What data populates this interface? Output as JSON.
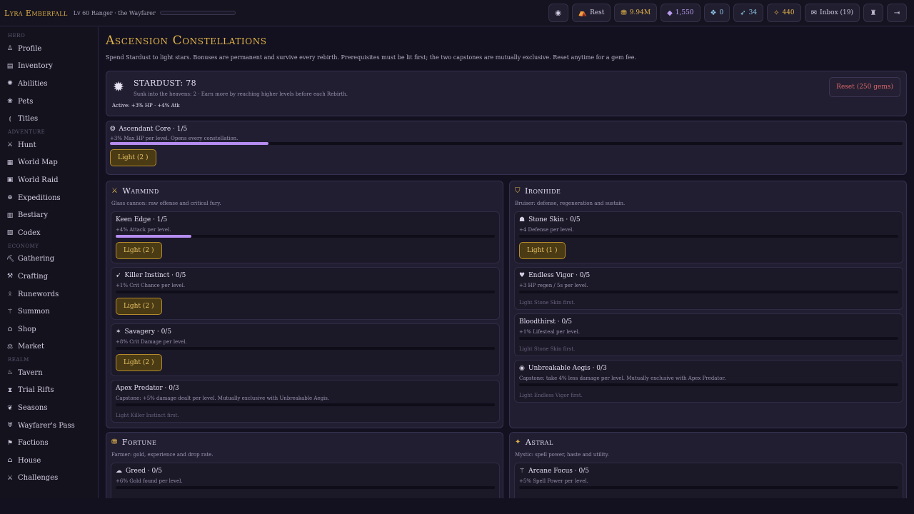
{
  "header": {
    "player_name": "Lyra Emberfall",
    "player_subtitle": "Lv 60 Ranger · the Wayfarer",
    "rest_label": "Rest",
    "gold": "9.94M",
    "gems": "1,550",
    "essence": "0",
    "feathers": "34",
    "stardust": "440",
    "inbox_label": "Inbox (19)"
  },
  "sidebar": {
    "sections": [
      {
        "label": "HERO",
        "items": [
          {
            "label": "Profile",
            "icon": "person-icon"
          },
          {
            "label": "Inventory",
            "icon": "backpack-icon"
          },
          {
            "label": "Abilities",
            "icon": "sparkle-icon"
          },
          {
            "label": "Pets",
            "icon": "paw-icon"
          },
          {
            "label": "Titles",
            "icon": "scroll-icon"
          }
        ]
      },
      {
        "label": "ADVENTURE",
        "items": [
          {
            "label": "Hunt",
            "icon": "swords-icon"
          },
          {
            "label": "World Map",
            "icon": "map-icon"
          },
          {
            "label": "World Raid",
            "icon": "raid-icon"
          },
          {
            "label": "Expeditions",
            "icon": "compass-icon"
          },
          {
            "label": "Bestiary",
            "icon": "book-icon"
          },
          {
            "label": "Codex",
            "icon": "codex-icon"
          }
        ]
      },
      {
        "label": "ECONOMY",
        "items": [
          {
            "label": "Gathering",
            "icon": "pickaxe-icon"
          },
          {
            "label": "Crafting",
            "icon": "anvil-icon"
          },
          {
            "label": "Runewords",
            "icon": "rune-icon"
          },
          {
            "label": "Summon",
            "icon": "wand-icon"
          },
          {
            "label": "Shop",
            "icon": "shop-icon"
          },
          {
            "label": "Market",
            "icon": "scale-icon"
          }
        ]
      },
      {
        "label": "REALM",
        "items": [
          {
            "label": "Tavern",
            "icon": "mug-icon"
          },
          {
            "label": "Trial Rifts",
            "icon": "rift-icon"
          },
          {
            "label": "Seasons",
            "icon": "leaf-icon"
          },
          {
            "label": "Wayfarer's Pass",
            "icon": "pass-icon"
          },
          {
            "label": "Factions",
            "icon": "flag-icon"
          },
          {
            "label": "House",
            "icon": "house-icon"
          },
          {
            "label": "Challenges",
            "icon": "challenge-icon"
          }
        ]
      }
    ]
  },
  "page": {
    "title": "Ascension Constellations",
    "description": "Spend Stardust to light stars. Bonuses are permanent and survive every rebirth. Prerequisites must be lit first; the two capstones are mutually exclusive. Reset anytime for a gem fee."
  },
  "stardust_card": {
    "title": "STARDUST: 78",
    "subtitle": "Sunk into the heavens: 2 · Earn more by reaching higher levels before each Rebirth.",
    "active": "Active: +3% HP · +4% Atk",
    "reset_label": "Reset (250 gems)"
  },
  "core": {
    "title": "Ascendant Core · 1/5",
    "desc": "+3% Max HP per level. Opens every constellation.",
    "progress": 0.2,
    "button": "Light (2 )"
  },
  "groups": {
    "warmind": {
      "name": "Warmind",
      "desc": "Glass cannon: raw offense and critical fury.",
      "nodes": [
        {
          "title": "Keen Edge · 1/5",
          "desc": "+4% Attack per level.",
          "progress": 0.2,
          "button": "Light (2 )"
        },
        {
          "title": "Killer Instinct · 0/5",
          "desc": "+1% Crit Chance per level.",
          "progress": 0,
          "button": "Light (2 )"
        },
        {
          "title": "Savagery · 0/5",
          "desc": "+8% Crit Damage per level.",
          "progress": 0,
          "button": "Light (2 )"
        },
        {
          "title": "Apex Predator · 0/3",
          "desc": "Capstone: +5% damage dealt per level. Mutually exclusive with Unbreakable Aegis.",
          "progress": 0,
          "locked": "Light Killer Instinct first."
        }
      ]
    },
    "ironhide": {
      "name": "Ironhide",
      "desc": "Bruiser: defense, regeneration and sustain.",
      "nodes": [
        {
          "title": "Stone Skin · 0/5",
          "desc": "+4 Defense per level.",
          "progress": 0,
          "button": "Light (1 )"
        },
        {
          "title": "Endless Vigor · 0/5",
          "desc": "+3 HP regen / 5s per level.",
          "progress": 0,
          "locked": "Light Stone Skin first."
        },
        {
          "title": "Bloodthirst · 0/5",
          "desc": "+1% Lifesteal per level.",
          "progress": 0,
          "locked": "Light Stone Skin first."
        },
        {
          "title": "Unbreakable Aegis · 0/3",
          "desc": "Capstone: take 4% less damage per level. Mutually exclusive with Apex Predator.",
          "progress": 0,
          "locked": "Light Endless Vigor first."
        }
      ]
    },
    "fortune": {
      "name": "Fortune",
      "desc": "Farmer: gold, experience and drop rate.",
      "nodes": [
        {
          "title": "Greed · 0/5",
          "desc": "+6% Gold found per level.",
          "progress": 0
        }
      ]
    },
    "astral": {
      "name": "Astral",
      "desc": "Mystic: spell power, haste and utility.",
      "nodes": [
        {
          "title": "Arcane Focus · 0/5",
          "desc": "+5% Spell Power per level.",
          "progress": 0
        }
      ]
    }
  }
}
